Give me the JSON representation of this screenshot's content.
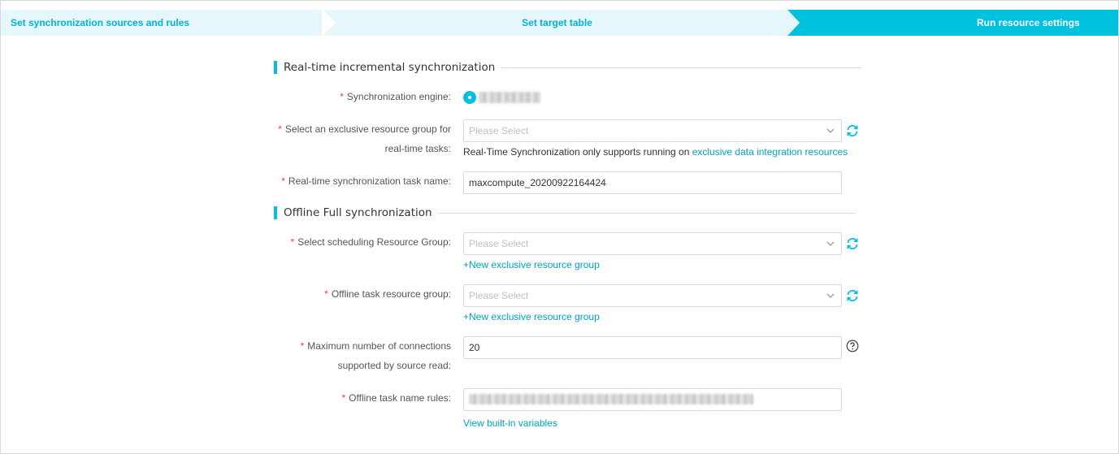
{
  "steps": [
    {
      "label": "Set synchronization sources and rules"
    },
    {
      "label": "Set target table"
    },
    {
      "label": "Run resource settings"
    }
  ],
  "realtime": {
    "title": "Real-time incremental synchronization",
    "engine_label": "Synchronization engine:",
    "resource_group_label_line1": "Select an exclusive resource group for",
    "resource_group_label_line2": "real-time tasks:",
    "resource_group_placeholder": "Please Select",
    "note_text": "Real-Time Synchronization only supports running on ",
    "note_link": "exclusive data integration resources",
    "task_name_label": "Real-time synchronization task name:",
    "task_name_value": "maxcompute_20200922164424"
  },
  "offline": {
    "title": "Offline Full synchronization",
    "scheduling_label": "Select scheduling Resource Group:",
    "scheduling_placeholder": "Please Select",
    "new_group_link_1": "+New exclusive resource group",
    "task_group_label": "Offline task resource group:",
    "task_group_placeholder": "Please Select",
    "new_group_link_2": "+New exclusive resource group",
    "max_conn_label_line1": "Maximum number of connections",
    "max_conn_label_line2": "supported by source read:",
    "max_conn_value": "20",
    "name_rules_label": "Offline task name rules:",
    "view_variables_link": "View built-in variables"
  },
  "colors": {
    "accent": "#00c1de",
    "link": "#00a2c4",
    "required": "#f04134"
  }
}
